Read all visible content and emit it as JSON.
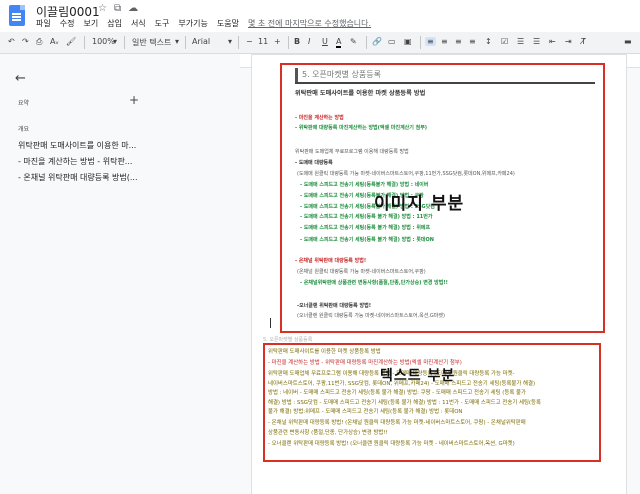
{
  "app": {
    "doc_title": "이끌림0001",
    "menu": [
      "파일",
      "수정",
      "보기",
      "삽입",
      "서식",
      "도구",
      "부가기능",
      "도움말"
    ],
    "last_edit": "몇 초 전에 마지막으로 수정했습니다."
  },
  "toolbar": {
    "zoom": "100%",
    "style": "일반 텍스트",
    "font": "Arial",
    "font_size": "11",
    "bold": "B",
    "italic": "I",
    "underline": "U",
    "text_color": "A"
  },
  "sidebar": {
    "summary_label": "요약",
    "outline_label": "개요",
    "outline_items": [
      "위탁판매 도매사이트를 이용한 마...",
      "- 마진을 계산하는 방법 - 위탁판...",
      "- 온채널 위탁판매 대량등록 방법(..."
    ]
  },
  "image_section": {
    "heading": "5. 오픈마켓별 상품등록",
    "label": "이미지 부분",
    "lines": [
      {
        "text": "위탁판매 도매사이트를 이용한 마켓 상품등록 방법",
        "style": "dark"
      },
      {
        "text": "- 마진을 계산하는 방법",
        "style": "red"
      },
      {
        "text": "- 위탁판매 대량등록 마진계산하는 방법(엑셀 마진계산기 첨부)",
        "style": "green"
      },
      {
        "text": "위탁판매 도매업체 무료프로그램 이용해 대량등록 방법",
        "style": "gray"
      },
      {
        "text": "- 도매매 대량등록",
        "style": "dark"
      },
      {
        "text": "(도매매 원클릭 대량등록 가능 마켓-네이버스마트스토어,쿠팡,11번가,SSG닷컴,롯데ON,위메프,카페24)",
        "style": "gray"
      },
      {
        "text": "- 도매매 스피드고 전송기 세팅(등록불가 해결) 방법 : 네이버",
        "style": "green"
      },
      {
        "text": "- 도매매 스피드고 전송기 세팅(등록불가 해결) 방법 : 쿠팡",
        "style": "green"
      },
      {
        "text": "- 도매매 스피드고 전송기 세팅(등록불가 해결) 방법 : SSG닷컴",
        "style": "green"
      },
      {
        "text": "- 도매매 스피드고 전송기 세팅(등록 불가 해결) 방법 : 11번가",
        "style": "green"
      },
      {
        "text": "- 도매매 스피드고 전송기 세팅(등록 불가 해결) 방법 : 위메프",
        "style": "green"
      },
      {
        "text": "- 도매매 스피드고 전송기 세팅(등록 불가 해결) 방법 : 롯데ON",
        "style": "green"
      },
      {
        "text": "- 온채널 위탁판매 대량등록 방법!",
        "style": "red"
      },
      {
        "text": "(온채널 원클릭 대량등록 가능 마켓-네이버스마트스토어,쿠팡)",
        "style": "gray"
      },
      {
        "text": "- 온채널위탁판매 상품관련 변동사항(품절,단종,단가상승) 변경 방법!!",
        "style": "green"
      },
      {
        "text": "-오너클랜 위탁판매 대량등록 방법!",
        "style": "dark"
      },
      {
        "text": "(오너클랜 원클릭 대량등록 가능 마켓-네이버스마트스토어,옥션,G마켓)",
        "style": "gray"
      }
    ]
  },
  "text_section": {
    "heading": "5. 오픈마켓별 상품등록",
    "label": "텍스트 부분",
    "lines": [
      {
        "text": "위탁판매 도매사이트를 이용한 마켓 상품등록 방법",
        "style": "olive"
      },
      {
        "text": "- 마진을 계산하는 방법 - 위탁판매 대량등록 마진계산하는 방법(엑셀 마진계산기 첨부)",
        "style": "red"
      },
      {
        "text": "위탁판매 도매업체 무료프로그램 이용해 대량등록 방법 - 도매매 대량등록 (도매매 원클릭 대량등록 가능 마켓-",
        "style": "olive"
      },
      {
        "text": "네이버스마트스토어, 쿠팡,11번가, SSG닷컴, 롯데ON, 위메프,카페24) - 도매매 스피드고 전송기 세팅(등록불가 해결)",
        "style": "olive"
      },
      {
        "text": "방법 : 네이버 - 도매매 스피드고 전송기 세팅(등록 불가 해결) 방법: 쿠팡 - 도매매 스피드고 전송기 세팅 (등록 불가",
        "style": "olive"
      },
      {
        "text": "해결) 방법 : SSG닷컴 - 도매매 스피드고 전송기 세팅(등록 불가 해결) 방법 : 11번가 - 도매매 스피드고 전송기 세팅(등록",
        "style": "olive"
      },
      {
        "text": "불가 해결) 방법:위메프 - 도매매 스피드고 전송기 세팅(등록 불가 해결) 방법 : 롯데ON",
        "style": "olive"
      },
      {
        "text": "- 온채널 위탁판매 대량등록 방법! (온채널 원클릭 대량등록 가능 마켓-네이버스마트스토어, 쿠팡) - 온채널위탁판매",
        "style": "olive"
      },
      {
        "text": "상품관련 변동사항 (품절,단종, 단가상승) 변경 방법!!",
        "style": "olive"
      },
      {
        "text": "- 오너클랜 위탁판매 대량등록 방법! (오너클랜 원클릭 대량등록 가능 마켓 - 네이버스마트스토어,옥션, G마켓)",
        "style": "olive"
      }
    ]
  }
}
